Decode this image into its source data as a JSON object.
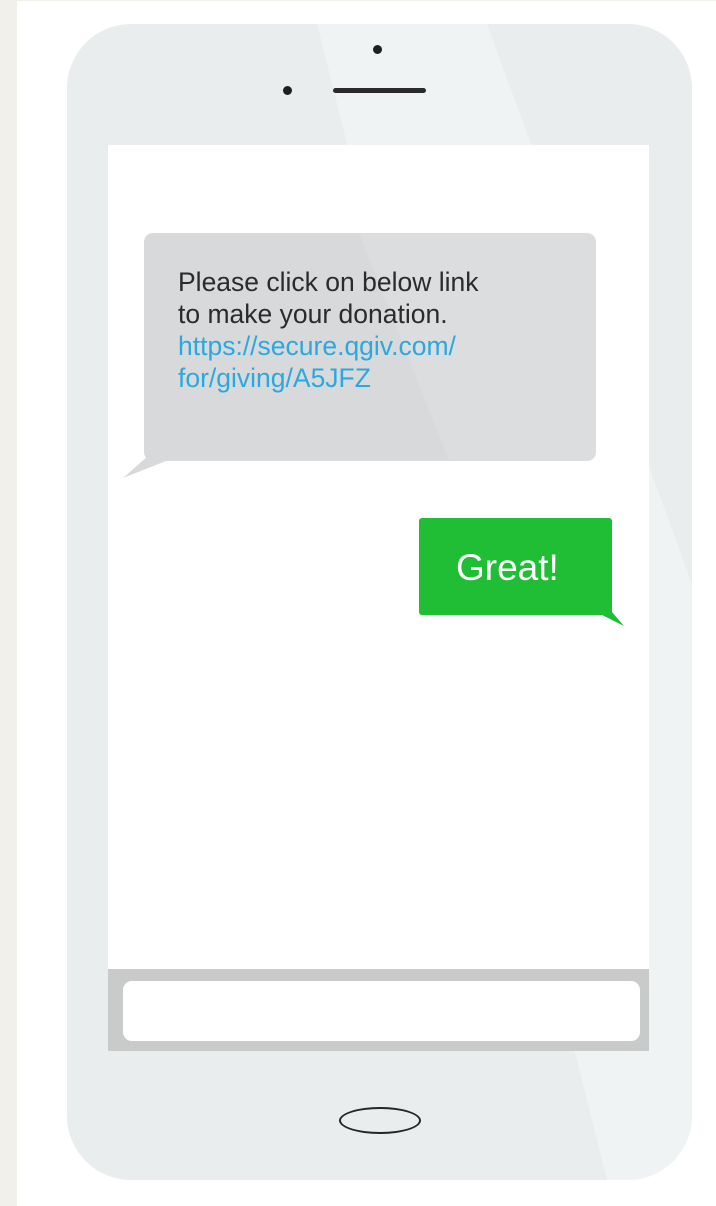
{
  "conversation": {
    "incoming_message": {
      "lines": [
        "Please click on below link",
        "to make your donation."
      ],
      "link_lines": [
        "https://secure.qgiv.com/",
        "for/giving/A5JFZ"
      ]
    },
    "outgoing_message": {
      "text": "Great!"
    }
  },
  "composer": {
    "value": "",
    "placeholder": ""
  },
  "colors": {
    "incoming_bubble": "#d8d9da",
    "outgoing_bubble": "#1fbe35",
    "link": "#2aa9e0",
    "phone_body": "#e9eded",
    "page_background": "#f2f0ea"
  }
}
